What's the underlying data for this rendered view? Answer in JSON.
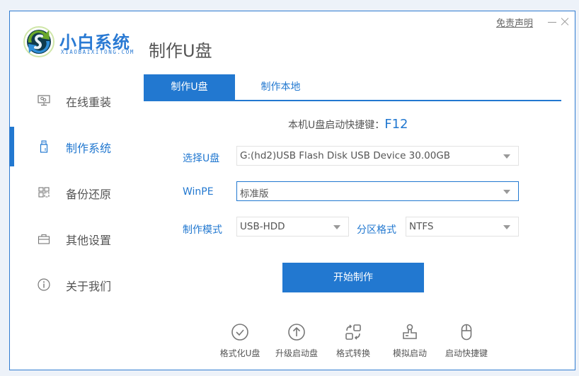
{
  "app": {
    "logo_cn": "小白系统",
    "logo_en": "XIAOBAIXITONG.COM",
    "page_title": "制作U盘",
    "disclaimer_link": "免责声明"
  },
  "sidebar": {
    "items": [
      {
        "label": "在线重装",
        "icon": "monitor-icon",
        "active": false
      },
      {
        "label": "制作系统",
        "icon": "usb-drive-icon",
        "active": true
      },
      {
        "label": "备份还原",
        "icon": "grid-icon",
        "active": false
      },
      {
        "label": "其他设置",
        "icon": "briefcase-icon",
        "active": false
      },
      {
        "label": "关于我们",
        "icon": "info-icon",
        "active": false
      }
    ]
  },
  "tabs": [
    {
      "label": "制作U盘",
      "active": true
    },
    {
      "label": "制作本地",
      "active": false
    }
  ],
  "hotkey": {
    "label": "本机U盘启动快捷键：",
    "key": "F12"
  },
  "form": {
    "usb_label": "选择U盘",
    "usb_value": "G:(hd2)USB Flash Disk USB Device 30.00GB",
    "winpe_label": "WinPE",
    "winpe_value": "标准版",
    "mode_label": "制作模式",
    "mode_value": "USB-HDD",
    "partition_label": "分区格式",
    "partition_value": "NTFS"
  },
  "start_button": "开始制作",
  "tools": [
    {
      "label": "格式化U盘",
      "icon": "check-circle-icon"
    },
    {
      "label": "升级启动盘",
      "icon": "arrow-up-circle-icon"
    },
    {
      "label": "格式转换",
      "icon": "convert-icon"
    },
    {
      "label": "模拟启动",
      "icon": "stamp-icon"
    },
    {
      "label": "启动快捷键",
      "icon": "mouse-icon"
    }
  ],
  "colors": {
    "accent": "#2278d0",
    "text": "#555555",
    "border": "#e2e2e2",
    "backdrop": "#edf2f9"
  }
}
